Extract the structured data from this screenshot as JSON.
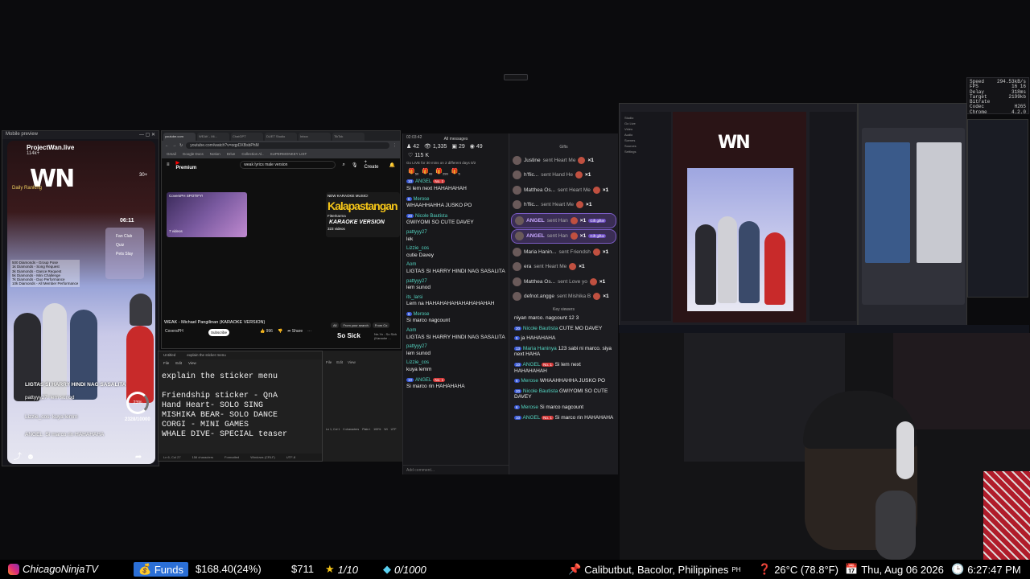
{
  "stats": {
    "rows": [
      {
        "k": "Speed",
        "v": "294.53kB/s"
      },
      {
        "k": "FPS",
        "v": "16 16"
      },
      {
        "k": "Delay",
        "v": "318ms"
      },
      {
        "k": "Target Bitrate",
        "v": "2199kb"
      },
      {
        "k": "Codec",
        "v": "H265"
      },
      {
        "k": "Chrome",
        "v": "4.2.0"
      }
    ]
  },
  "mobile": {
    "window_title": "Mobile preview",
    "channel": "ProjectWan.live",
    "likes": "114k+",
    "brand": "WN",
    "ranking": "Daily Ranking",
    "viewers": "30+",
    "timer": "06:11",
    "menu": [
      "Fan Club",
      "Quiz",
      "Pets Slay"
    ],
    "rules": [
      "500 Diamonds - Group Pose",
      "1k Diamonds - Song Request",
      "3k Diamonds - Dance Request",
      "5k Diamonds - Mini Challenge",
      "7k Diamonds - Duo Performance",
      "10k Diamonds - All Member Performance"
    ],
    "overlay": "LIGTAS SI HARRY HINDI NAG SASALITA",
    "comments": [
      {
        "user": "pattyyy27",
        "text": "lem sunod"
      },
      {
        "user": "Lizzie_cos",
        "text": "kuya lemm"
      },
      {
        "user": "ANGEL",
        "text": "Si marco rin HAHAHAHA"
      }
    ],
    "gauge": "23%",
    "goal": "2328/10000"
  },
  "browser": {
    "tabs": [
      "youtube.com",
      "WEAK - Mi...",
      "ChatGPT",
      "DUET Studio",
      "Inbox",
      "TikTok"
    ],
    "url": "youtube.com/watch?v=oqpDXBsbPhM",
    "bookmarks": [
      "Gmail",
      "Google Docs",
      "Notion",
      "Drive",
      "Collection Al..",
      "SUPERMONKEY LIST"
    ],
    "logo": "Premium",
    "search": "weak lyrics male version",
    "create": "+ Create",
    "thumb1_label": "CoversPH SPOTIFY!",
    "thumb1_count": "7 videos",
    "thumb2_label": "NEW KARAOKE MUSIC!",
    "thumb2_big": "Kalapastangan",
    "thumb2_sub": "Fitterkarma",
    "thumb2_k": "KARAOKE VERSION",
    "thumb2_count": "323 videos",
    "video_title": "WEAK - Michael Pangilinan (KARAOKE VERSION)",
    "channel": "CoversPH",
    "subscribe": "Subscribe",
    "likes": "996",
    "share": "Share",
    "filters": [
      "All",
      "From your search",
      "From Co"
    ],
    "side_title": "So Sick",
    "side_sub": "Ne-Yo - So Sick (Karaoke ..."
  },
  "notepad": {
    "tabs": [
      "Untitled",
      "explain the sticker menu"
    ],
    "menu": [
      "File",
      "Edit",
      "View"
    ],
    "body": "explain the sticker menu\n\nFriendship sticker - QnA\nHand Heart- SOLO SING\nMISHIKA BEAR- SOLO DANCE\nCORGI - MINI GAMES\nWHALE DIVE- SPECIAL teaser",
    "status": [
      "Ln 6, Col 27",
      "156 characters",
      "Formatted",
      "Windows (CRLF)",
      "UTF-8"
    ],
    "status2": [
      "Ln 1, Col 1",
      "0 characters",
      "Plain t",
      "100%",
      "Wi",
      "UTF"
    ]
  },
  "chat": {
    "time": "02:03:42",
    "title": "All messages",
    "counts": {
      "a": "42",
      "b": "1,335",
      "c": "29",
      "d": "49"
    },
    "likes": "115 K",
    "notice": "Go LIVE for 30 mins on 2 different days",
    "progress": "0/2",
    "gift_counts": [
      "50",
      "99",
      "299",
      "5"
    ],
    "messages": [
      {
        "lv": "10",
        "user": "ANGEL",
        "n1": "No. 1",
        "text": "Si lem next HAHAHAHAH"
      },
      {
        "lv": "6",
        "user": "Merose",
        "n1": "",
        "text": "WHAAHHAHHA JUSKO PO"
      },
      {
        "lv": "20",
        "user": "Nicole Bautista",
        "n1": "",
        "text": "GWIYOMI SO CUTE DAVEY"
      },
      {
        "lv": "",
        "user": "pattyyy27",
        "n1": "",
        "text": "lek"
      },
      {
        "lv": "",
        "user": "Lizzie_cos",
        "n1": "",
        "text": "cutie Davey"
      },
      {
        "lv": "",
        "user": "Aom",
        "n1": "",
        "text": "LIGTAS SI HARRY HINDI NAG SASALITA"
      },
      {
        "lv": "",
        "user": "pattyyy27",
        "n1": "",
        "text": "lem sunod"
      },
      {
        "lv": "",
        "user": "its_larsi",
        "n1": "",
        "text": "Lem na HAHAHAHAHAHAHAHAHAH"
      },
      {
        "lv": "6",
        "user": "Merose",
        "n1": "",
        "text": "Si marco nagcount"
      },
      {
        "lv": "",
        "user": "Aom",
        "n1": "",
        "text": "LIGTAS SI HARRY HINDI NAG SASALITA"
      },
      {
        "lv": "",
        "user": "pattyyy27",
        "n1": "",
        "text": "lem sunod"
      },
      {
        "lv": "",
        "user": "Lizzie_cos",
        "n1": "",
        "text": "kuya lemm"
      },
      {
        "lv": "10",
        "user": "ANGEL",
        "n1": "No. 1",
        "text": "Si marco rin HAHAHAHA"
      }
    ],
    "footer": "Add comment..."
  },
  "gifts": {
    "title": "Gifts",
    "rows": [
      {
        "user": "Justine",
        "gift": "sent Heart Me",
        "x": "×1",
        "hl": false
      },
      {
        "user": "h'flic...",
        "gift": "sent Hand He",
        "x": "×1",
        "hl": false
      },
      {
        "user": "Matthea Os...",
        "gift": "sent Heart Me",
        "x": "×1",
        "hl": false
      },
      {
        "user": "h'flic...",
        "gift": "sent Heart Me",
        "x": "×1",
        "hl": false
      },
      {
        "user": "ANGEL",
        "gift": "sent Han",
        "x": "×1",
        "hl": true
      },
      {
        "user": "ANGEL",
        "gift": "sent Han",
        "x": "×1",
        "hl": true
      },
      {
        "user": "Maria Hanin...",
        "gift": "sent Friendsh",
        "x": "×1",
        "hl": false
      },
      {
        "user": "era",
        "gift": "sent Heart Me",
        "x": "×1",
        "hl": false
      },
      {
        "user": "Matthea Os...",
        "gift": "sent Love yo",
        "x": "×1",
        "hl": false
      },
      {
        "user": "defnot.angge",
        "gift": "sent Mishika B",
        "x": "×1",
        "hl": false
      }
    ],
    "gifter_tag": "Gift gifter",
    "key_title": "Key viewers",
    "key": [
      {
        "lv": "",
        "user": "",
        "n1": "",
        "text": "niyan marco. nagcount 12 3"
      },
      {
        "lv": "20",
        "user": "Nicole Bautista",
        "n1": "",
        "text": "CUTE MO DAVEY"
      },
      {
        "lv": "5",
        "user": "",
        "n1": "",
        "text": "ja HAHAHAHA"
      },
      {
        "lv": "13",
        "user": "Maria Haninya",
        "n1": "",
        "text": "123 sabi ni marco. siya next HAHA"
      },
      {
        "lv": "10",
        "user": "ANGEL",
        "n1": "No. 1",
        "text": "Si lem next HAHAHAHAH"
      },
      {
        "lv": "6",
        "user": "Merose",
        "n1": "",
        "text": "WHAAHHAHHA JUSKO PO"
      },
      {
        "lv": "20",
        "user": "Nicole Bautista",
        "n1": "",
        "text": "GWIYOMI SO CUTE DAVEY"
      },
      {
        "lv": "6",
        "user": "Merose",
        "n1": "",
        "text": "Si marco nagcount"
      },
      {
        "lv": "10",
        "user": "ANGEL",
        "n1": "No. 1",
        "text": "Si marco rin HAHAHAHA"
      }
    ]
  },
  "obs": {
    "brand": "WN",
    "dock": [
      "Studio",
      "Go Live",
      "Video",
      "Audio",
      "Scenes",
      "Sources",
      "Settings"
    ]
  },
  "bar": {
    "handle": "ChicagoNinjaTV",
    "funds_label": "Funds",
    "funds_value": "$168.40(24%)",
    "money": "$711",
    "stars": "1/10",
    "diamonds": "0/1000",
    "location": "Calibutbut, Bacolor, Philippines",
    "country": "PH",
    "weather": "26°C (78.8°F)",
    "date": "Thu, Aug 06 2026",
    "time": "6:27:47 PM"
  }
}
